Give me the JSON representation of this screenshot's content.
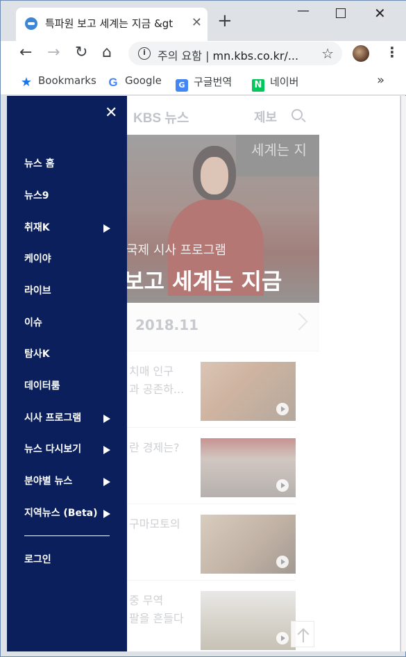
{
  "browser": {
    "tab_title": "특파원 보고 세계는 지금 &gt",
    "new_tab_symbol": "+",
    "omnibox": {
      "security_label": "주의 요함",
      "separator": "|",
      "url": "mn.kbs.co.kr/..."
    },
    "bookmarks": [
      {
        "label": "Bookmarks",
        "icon": "star-icon"
      },
      {
        "label": "Google",
        "icon": "google-icon"
      },
      {
        "label": "구글번역",
        "icon": "google-translate-icon"
      },
      {
        "label": "네이버",
        "icon": "naver-icon"
      }
    ],
    "bookmarks_more": "»"
  },
  "page": {
    "logo": "KBS 뉴스",
    "report_label": "제보",
    "hero": {
      "bg_sign": "세계는 지",
      "subtitle": "국제 시사 프로그램",
      "title": "보고 세계는 지금"
    },
    "date": "2018.11",
    "articles": [
      {
        "line1": "치매 인구",
        "line2": "과 공존하..."
      },
      {
        "line1": "란 경제는?",
        "line2": ""
      },
      {
        "line1": "구마모토의",
        "line2": ""
      },
      {
        "line1": "중 무역",
        "line2": "팔을 흔들다"
      }
    ]
  },
  "drawer": {
    "close_symbol": "✕",
    "items": [
      {
        "label": "뉴스 홈",
        "has_submenu": false
      },
      {
        "label": "뉴스9",
        "has_submenu": false
      },
      {
        "label": "취재K",
        "has_submenu": true
      },
      {
        "label": "케이야",
        "has_submenu": false
      },
      {
        "label": "라이브",
        "has_submenu": false
      },
      {
        "label": "이슈",
        "has_submenu": false
      },
      {
        "label": "탐사K",
        "has_submenu": false
      },
      {
        "label": "데이터룸",
        "has_submenu": false
      },
      {
        "label": "시사 프로그램",
        "has_submenu": true
      },
      {
        "label": "뉴스 다시보기",
        "has_submenu": true
      },
      {
        "label": "분야별 뉴스",
        "has_submenu": true
      },
      {
        "label": "지역뉴스 (Beta)",
        "has_submenu": true
      }
    ],
    "login_label": "로그인"
  },
  "colors": {
    "drawer_bg": "#0a1f5c",
    "chrome_bg": "#dee1e6",
    "accent_blue": "#1a73e8",
    "naver_green": "#03c75a"
  }
}
